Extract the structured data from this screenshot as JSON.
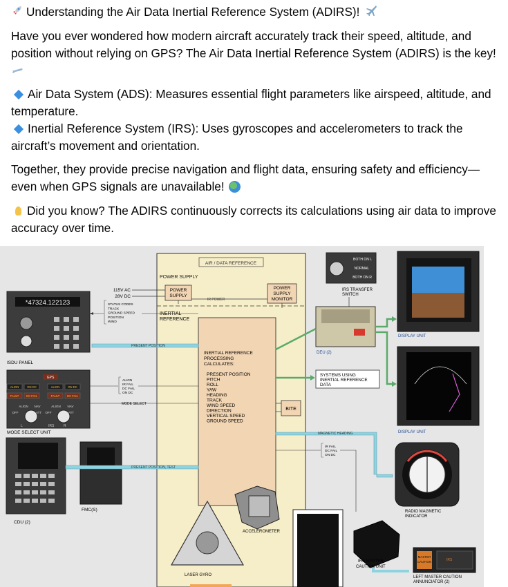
{
  "post": {
    "line1_emoji": "rocket-icon",
    "title": "Understanding the Air Data Inertial Reference System (ADIRS)!",
    "intro": "Have you ever wondered how modern aircraft accurately track their speed, altitude, and position without relying on GPS? The Air Data Inertial Reference System (ADIRS) is the key!",
    "ads": "Air Data System (ADS): Measures essential flight parameters like airspeed, altitude, and temperature.",
    "irs": "Inertial Reference System (IRS): Uses gyroscopes and accelerometers to track the aircraft’s movement and orientation.",
    "together": "Together, they provide precise navigation and flight data, ensuring safety and efficiency—even when GPS signals are unavailable!",
    "did_you_know": "Did you know? The ADIRS continuously corrects its calculations using air data to improve accuracy over time."
  },
  "diagram": {
    "air_data_reference": "AIR / DATA REFERENCE",
    "power_supply_label": "POWER SUPPLY",
    "power_supply_box": [
      "POWER",
      "SUPPLY"
    ],
    "power_supply_monitor": [
      "POWER",
      "SUPPLY",
      "MONITOR"
    ],
    "ir_power": "IR POWER",
    "inertial_reference": [
      "INERTIAL",
      "REFERENCE"
    ],
    "ac_115": "115V AC",
    "dc_28": "28V DC",
    "status_codes": [
      "STATUS CODES",
      "TRACK",
      "GROUND SPEED",
      "POSITION",
      "WIND"
    ],
    "isdu_display": "*47324.122123",
    "isdu_panel": "ISDU PANEL",
    "present_position": "PRESENT POSITION",
    "processing": [
      "INERTIAL REFERENCE",
      "PROCESSING",
      "CALCULATES:"
    ],
    "calc_items": [
      "PRESENT POSITION",
      "PITCH",
      "ROLL",
      "YAW",
      "HEADING",
      "TRACK",
      "WIND SPEED",
      "DIRECTION",
      "VERTICAL SPEED",
      "GROUND SPEED"
    ],
    "bite": "BITE",
    "mode_labels": [
      "ALIGN",
      "IR FAIL",
      "DC FAIL",
      "ON DC"
    ],
    "mode_select": "MODE SELECT",
    "mode_select_unit": "MODE SELECT UNIT",
    "gps": "GPS",
    "msu_buttons": [
      "ALIGN",
      "ON DC",
      "ALIGN",
      "ON DC",
      "FAULT",
      "DC FAIL",
      "FAULT",
      "DC FAIL"
    ],
    "knob_labels": [
      "ALIGN",
      "NAV",
      "OFF",
      "ATT",
      "ALIGN",
      "NAV",
      "OFF",
      "ATT"
    ],
    "irs_lr": [
      "L",
      "IRS",
      "R"
    ],
    "present_position_test": "PRESENT POSITION, TEST",
    "fmcs": "FMC(S)",
    "cdu": "CDU (2)",
    "switch_labels": [
      "BOTH ON L",
      "NORMAL",
      "BOTH ON R"
    ],
    "irs_transfer_switch": [
      "IRS TRANSFER",
      "SWITCH"
    ],
    "deu": "DEU (2)",
    "systems_using": [
      "SYSTEMS USING",
      "INERTIAL REFERENCE",
      "DATA"
    ],
    "display_unit": "DISPLAY UNIT",
    "magnetic_heading": "MAGNETIC HEADING",
    "ir_fail_labels": [
      "IR FAIL",
      "DC FAIL",
      "ON DC"
    ],
    "rmi": [
      "RADIO MAGNETIC",
      "INDICATOR"
    ],
    "accelerometer": "ACCELEROMETER",
    "laser_gyro": "LASER GYRO",
    "irs_master_caution": [
      "IRS MASTER",
      "CAUTION UNIT"
    ],
    "left_master_caution": [
      "LEFT MASTER CAUTION",
      "ANNUNCIATOR (2)"
    ],
    "annunciator_texts": [
      "MASTER",
      "CAUTION",
      "IRS"
    ],
    "colors": {
      "beige": "#f6edc9",
      "box_beige": "#f2d5b3",
      "cyan_line": "#8fd3e0",
      "green_line": "#5aaa6a",
      "bg": "#e6e6e6"
    }
  }
}
